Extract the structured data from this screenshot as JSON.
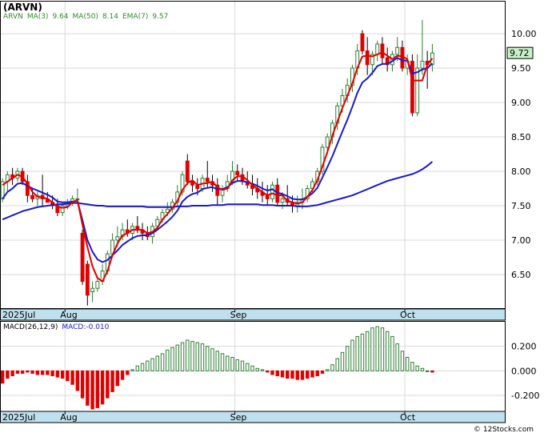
{
  "ticker_label": "(ARVN)",
  "legend_price": [
    {
      "text": "ARVN",
      "color": "#2e8b2e"
    },
    {
      "text": "MA(3)",
      "color": "#2e8b2e"
    },
    {
      "text": "9.64",
      "color": "#2e8b2e"
    },
    {
      "text": "MA(50)",
      "color": "#2e8b2e"
    },
    {
      "text": "8.14",
      "color": "#2e8b2e"
    },
    {
      "text": "EMA(7)",
      "color": "#2e8b2e"
    },
    {
      "text": "9.57",
      "color": "#2e8b2e"
    }
  ],
  "legend_macd": [
    {
      "text": "MACD(26,12,9)",
      "color": "#000000"
    },
    {
      "text": "MACD:-0.010",
      "color": "#1a1acc"
    }
  ],
  "watermark": "© 12Stocks.com",
  "last_price_tag": "9.72",
  "colors": {
    "up": "#2e7d32",
    "down": "#e00000",
    "ma3": "#e00000",
    "ema7": "#1a1acc",
    "ma50": "#1a1acc",
    "axis_bar": "#bfe0ee",
    "grid": "#d9d9d9",
    "price_tag_bg": "#c8f2c8"
  },
  "chart_data": [
    {
      "type": "candlestick",
      "title": "(ARVN)",
      "y_ticks": [
        "10.00",
        "9.50",
        "9.00",
        "8.50",
        "8.00",
        "7.50",
        "7.00",
        "6.50"
      ],
      "y_tick_values": [
        10.0,
        9.5,
        9.0,
        8.5,
        8.0,
        7.5,
        7.0,
        6.5
      ],
      "ylim": [
        6.0,
        10.35
      ],
      "x_ticks": [
        "2025Jul",
        "Aug",
        "Sep",
        "Oct"
      ],
      "x_tick_index": [
        0,
        13,
        47,
        81
      ],
      "num_bars": 101,
      "candles": [
        [
          7.6,
          7.9,
          7.55,
          7.85
        ],
        [
          7.85,
          8.0,
          7.7,
          7.95
        ],
        [
          7.95,
          8.05,
          7.8,
          7.9
        ],
        [
          7.9,
          8.05,
          7.85,
          8.0
        ],
        [
          8.0,
          8.05,
          7.8,
          7.85
        ],
        [
          7.85,
          7.95,
          7.55,
          7.65
        ],
        [
          7.65,
          7.75,
          7.55,
          7.6
        ],
        [
          7.6,
          7.7,
          7.5,
          7.65
        ],
        [
          7.65,
          7.95,
          7.5,
          7.6
        ],
        [
          7.6,
          7.7,
          7.55,
          7.55
        ],
        [
          7.55,
          7.65,
          7.45,
          7.5
        ],
        [
          7.5,
          7.6,
          7.35,
          7.4
        ],
        [
          7.4,
          7.55,
          7.35,
          7.5
        ],
        [
          7.5,
          7.6,
          7.45,
          7.55
        ],
        [
          7.55,
          7.65,
          7.5,
          7.6
        ],
        [
          7.6,
          7.75,
          7.55,
          7.6
        ],
        [
          7.1,
          7.15,
          6.35,
          6.4
        ],
        [
          6.65,
          6.7,
          6.05,
          6.2
        ],
        [
          6.25,
          6.4,
          6.1,
          6.3
        ],
        [
          6.3,
          6.45,
          6.25,
          6.4
        ],
        [
          6.4,
          6.65,
          6.35,
          6.55
        ],
        [
          6.55,
          6.85,
          6.5,
          6.8
        ],
        [
          6.8,
          7.1,
          6.75,
          7.0
        ],
        [
          7.0,
          7.2,
          6.9,
          7.05
        ],
        [
          7.05,
          7.25,
          7.0,
          7.15
        ],
        [
          7.15,
          7.3,
          7.05,
          7.1
        ],
        [
          7.1,
          7.25,
          7.0,
          7.2
        ],
        [
          7.2,
          7.35,
          7.1,
          7.15
        ],
        [
          7.15,
          7.25,
          7.0,
          7.1
        ],
        [
          7.1,
          7.2,
          7.0,
          7.05
        ],
        [
          7.05,
          7.25,
          6.95,
          7.2
        ],
        [
          7.2,
          7.35,
          7.15,
          7.3
        ],
        [
          7.3,
          7.45,
          7.25,
          7.4
        ],
        [
          7.4,
          7.55,
          7.35,
          7.45
        ],
        [
          7.45,
          7.6,
          7.4,
          7.55
        ],
        [
          7.55,
          7.8,
          7.5,
          7.7
        ],
        [
          7.7,
          8.0,
          7.65,
          7.95
        ],
        [
          8.15,
          8.25,
          7.8,
          7.85
        ],
        [
          7.85,
          7.95,
          7.7,
          7.8
        ],
        [
          7.8,
          7.9,
          7.65,
          7.75
        ],
        [
          7.75,
          7.95,
          7.7,
          7.9
        ],
        [
          7.9,
          8.15,
          7.75,
          7.85
        ],
        [
          7.85,
          7.95,
          7.7,
          7.8
        ],
        [
          7.8,
          7.9,
          7.5,
          7.65
        ],
        [
          7.65,
          7.8,
          7.55,
          7.75
        ],
        [
          7.75,
          7.95,
          7.7,
          7.85
        ],
        [
          7.85,
          8.15,
          7.8,
          8.0
        ],
        [
          8.0,
          8.1,
          7.85,
          7.95
        ],
        [
          7.95,
          8.05,
          7.8,
          7.85
        ],
        [
          7.85,
          8.0,
          7.75,
          7.8
        ],
        [
          7.8,
          7.95,
          7.65,
          7.75
        ],
        [
          7.75,
          7.9,
          7.6,
          7.7
        ],
        [
          7.7,
          7.85,
          7.55,
          7.65
        ],
        [
          7.65,
          7.8,
          7.5,
          7.6
        ],
        [
          7.6,
          7.85,
          7.55,
          7.8
        ],
        [
          7.8,
          7.9,
          7.5,
          7.55
        ],
        [
          7.55,
          7.7,
          7.45,
          7.6
        ],
        [
          7.6,
          7.8,
          7.5,
          7.55
        ],
        [
          7.55,
          7.65,
          7.4,
          7.5
        ],
        [
          7.5,
          7.65,
          7.4,
          7.55
        ],
        [
          7.55,
          7.75,
          7.45,
          7.6
        ],
        [
          7.6,
          7.8,
          7.55,
          7.75
        ],
        [
          7.75,
          7.9,
          7.7,
          7.85
        ],
        [
          7.85,
          8.05,
          7.8,
          8.0
        ],
        [
          8.0,
          8.4,
          7.95,
          8.35
        ],
        [
          8.35,
          8.55,
          8.25,
          8.5
        ],
        [
          8.5,
          8.75,
          8.4,
          8.7
        ],
        [
          8.7,
          9.0,
          8.6,
          8.95
        ],
        [
          8.95,
          9.2,
          8.85,
          9.1
        ],
        [
          9.1,
          9.35,
          9.0,
          9.25
        ],
        [
          9.25,
          9.55,
          9.15,
          9.5
        ],
        [
          9.5,
          9.85,
          9.4,
          9.75
        ],
        [
          10.0,
          10.05,
          9.7,
          9.75
        ],
        [
          9.75,
          9.95,
          9.4,
          9.55
        ],
        [
          9.55,
          9.75,
          9.4,
          9.7
        ],
        [
          9.7,
          9.9,
          9.6,
          9.85
        ],
        [
          9.85,
          9.95,
          9.55,
          9.65
        ],
        [
          9.65,
          9.8,
          9.45,
          9.55
        ],
        [
          9.55,
          9.75,
          9.45,
          9.7
        ],
        [
          9.7,
          9.95,
          9.6,
          9.8
        ],
        [
          9.8,
          9.9,
          9.45,
          9.5
        ],
        [
          9.5,
          9.7,
          9.4,
          9.6
        ],
        [
          9.6,
          9.7,
          8.8,
          8.85
        ],
        [
          8.85,
          9.7,
          8.8,
          9.5
        ],
        [
          9.5,
          10.2,
          9.4,
          9.6
        ],
        [
          9.6,
          9.75,
          9.2,
          9.55
        ],
        [
          9.55,
          9.85,
          9.45,
          9.72
        ]
      ],
      "ma3": [
        7.8,
        7.85,
        7.9,
        7.95,
        7.92,
        7.82,
        7.7,
        7.63,
        7.62,
        7.6,
        7.55,
        7.48,
        7.47,
        7.48,
        7.55,
        7.58,
        7.22,
        6.9,
        6.62,
        6.45,
        6.4,
        6.55,
        6.78,
        6.95,
        7.07,
        7.1,
        7.15,
        7.15,
        7.15,
        7.1,
        7.12,
        7.18,
        7.3,
        7.38,
        7.47,
        7.57,
        7.73,
        7.83,
        7.87,
        7.8,
        7.82,
        7.83,
        7.85,
        7.77,
        7.73,
        7.75,
        7.87,
        7.93,
        7.93,
        7.87,
        7.8,
        7.75,
        7.7,
        7.65,
        7.68,
        7.65,
        7.65,
        7.57,
        7.55,
        7.53,
        7.55,
        7.63,
        7.73,
        7.87,
        8.07,
        8.28,
        8.52,
        8.72,
        8.92,
        9.1,
        9.28,
        9.5,
        9.67,
        9.68,
        9.67,
        9.7,
        9.73,
        9.68,
        9.63,
        9.68,
        9.67,
        9.63,
        9.32,
        9.32,
        9.32,
        9.55,
        9.64
      ],
      "ema7": [
        7.6,
        7.7,
        7.75,
        7.82,
        7.83,
        7.79,
        7.75,
        7.72,
        7.69,
        7.66,
        7.62,
        7.56,
        7.55,
        7.55,
        7.56,
        7.57,
        7.29,
        7.0,
        6.83,
        6.72,
        6.68,
        6.71,
        6.78,
        6.85,
        6.93,
        6.98,
        7.03,
        7.06,
        7.07,
        7.07,
        7.1,
        7.15,
        7.21,
        7.27,
        7.34,
        7.43,
        7.56,
        7.63,
        7.67,
        7.69,
        7.74,
        7.76,
        7.77,
        7.74,
        7.74,
        7.77,
        7.83,
        7.86,
        7.86,
        7.84,
        7.82,
        7.79,
        7.75,
        7.72,
        7.74,
        7.69,
        7.67,
        7.64,
        7.6,
        7.59,
        7.59,
        7.63,
        7.68,
        7.76,
        7.91,
        8.06,
        8.22,
        8.4,
        8.58,
        8.75,
        8.94,
        9.14,
        9.29,
        9.35,
        9.43,
        9.53,
        9.56,
        9.56,
        9.6,
        9.65,
        9.61,
        9.61,
        9.42,
        9.44,
        9.48,
        9.5,
        9.57
      ],
      "ma50": [
        7.3,
        7.33,
        7.36,
        7.39,
        7.42,
        7.44,
        7.46,
        7.48,
        7.49,
        7.5,
        7.51,
        7.52,
        7.52,
        7.53,
        7.54,
        7.54,
        7.53,
        7.52,
        7.51,
        7.5,
        7.5,
        7.49,
        7.49,
        7.49,
        7.49,
        7.49,
        7.49,
        7.49,
        7.49,
        7.48,
        7.48,
        7.48,
        7.48,
        7.48,
        7.48,
        7.49,
        7.49,
        7.49,
        7.5,
        7.5,
        7.5,
        7.5,
        7.51,
        7.51,
        7.51,
        7.52,
        7.52,
        7.52,
        7.52,
        7.52,
        7.52,
        7.52,
        7.51,
        7.51,
        7.51,
        7.5,
        7.5,
        7.5,
        7.5,
        7.49,
        7.49,
        7.49,
        7.5,
        7.51,
        7.53,
        7.55,
        7.57,
        7.59,
        7.61,
        7.63,
        7.65,
        7.68,
        7.71,
        7.74,
        7.77,
        7.8,
        7.83,
        7.86,
        7.88,
        7.9,
        7.92,
        7.94,
        7.96,
        7.99,
        8.03,
        8.08,
        8.14
      ]
    },
    {
      "type": "bar",
      "title": "MACD(26,12,9)",
      "y_ticks": [
        "0.200",
        "0.000",
        "-0.200"
      ],
      "y_tick_values": [
        0.2,
        0.0,
        -0.2
      ],
      "ylim": [
        -0.33,
        0.4
      ],
      "x_ticks": [
        "2025Jul",
        "Aug",
        "Sep",
        "Oct"
      ],
      "x_tick_index": [
        0,
        13,
        47,
        81
      ],
      "values": [
        -0.1,
        -0.06,
        -0.04,
        -0.02,
        -0.02,
        -0.01,
        -0.02,
        -0.03,
        -0.03,
        -0.03,
        -0.04,
        -0.05,
        -0.06,
        -0.08,
        -0.11,
        -0.16,
        -0.22,
        -0.28,
        -0.31,
        -0.3,
        -0.27,
        -0.22,
        -0.17,
        -0.12,
        -0.07,
        -0.03,
        0.01,
        0.04,
        0.06,
        0.08,
        0.1,
        0.12,
        0.14,
        0.17,
        0.19,
        0.21,
        0.23,
        0.25,
        0.24,
        0.23,
        0.22,
        0.2,
        0.18,
        0.16,
        0.14,
        0.12,
        0.11,
        0.09,
        0.08,
        0.06,
        0.04,
        0.02,
        0.01,
        -0.01,
        -0.03,
        -0.04,
        -0.05,
        -0.06,
        -0.06,
        -0.07,
        -0.07,
        -0.06,
        -0.05,
        -0.04,
        -0.02,
        0.01,
        0.05,
        0.1,
        0.15,
        0.2,
        0.25,
        0.28,
        0.3,
        0.32,
        0.35,
        0.36,
        0.35,
        0.32,
        0.28,
        0.22,
        0.16,
        0.11,
        0.07,
        0.04,
        0.02,
        0.0,
        -0.01
      ]
    }
  ]
}
